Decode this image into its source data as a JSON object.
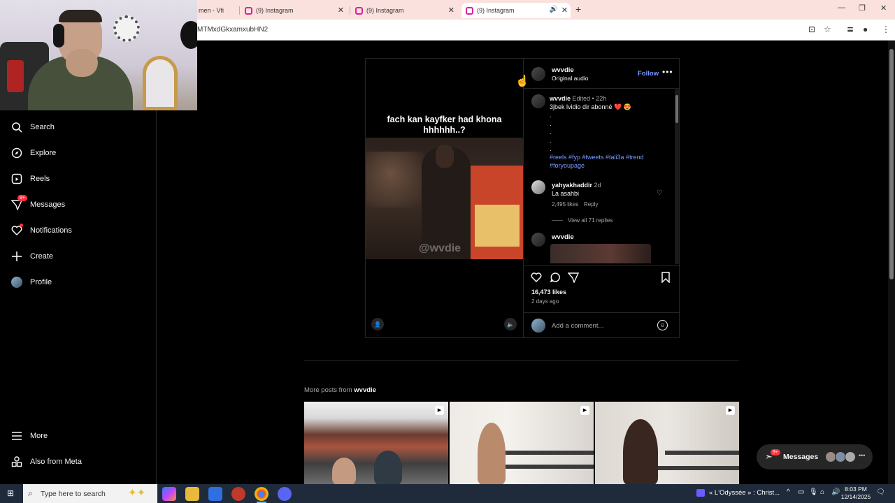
{
  "browser": {
    "tabs": [
      {
        "label": "men - Vfi"
      },
      {
        "label": "(9) Instagram"
      },
      {
        "label": "(9) Instagram"
      },
      {
        "label": "(9) Instagram"
      }
    ],
    "url": "MTMxdGkxamxubHN2"
  },
  "sidebar": {
    "items": [
      {
        "label": "Search"
      },
      {
        "label": "Explore"
      },
      {
        "label": "Reels"
      },
      {
        "label": "Messages",
        "badge": "9+"
      },
      {
        "label": "Notifications"
      },
      {
        "label": "Create"
      },
      {
        "label": "Profile"
      }
    ],
    "bottom": [
      {
        "label": "More"
      },
      {
        "label": "Also from Meta"
      }
    ]
  },
  "post": {
    "video_caption": "fach kan kayfker had khona hhhhhh..?",
    "watermark": "@wvdie",
    "header": {
      "username": "wvvdie",
      "audio": "Original audio",
      "follow": "Follow"
    },
    "caption": {
      "username": "wvvdie",
      "edited": "Edited",
      "sep": "•",
      "time": "22h",
      "text": "3jbek lvidio dir abonné ❤️ 😍",
      "dots": [
        ".",
        ".",
        ".",
        ".",
        "."
      ],
      "hashtags_1": "#reels #fyp #tweets #tali3a #trend",
      "hashtags_2": "#foryoupage"
    },
    "comment": {
      "username": "yahyakhaddir",
      "time": "2d",
      "text": "La asahbi",
      "likes": "2,495 likes",
      "reply": "Reply",
      "view_replies": "View all 71 replies"
    },
    "reply_user": "wvvdie",
    "likes": "16,473 likes",
    "posted": "2 days ago",
    "comment_placeholder": "Add a comment..."
  },
  "more_posts": {
    "prefix": "More posts from",
    "username": "wvvdie"
  },
  "messages_pill": {
    "label": "Messages",
    "badge": "9+"
  },
  "taskbar": {
    "search_placeholder": "Type here to search",
    "media": "« L'Odyssée » : Christ...",
    "time": "8:03 PM",
    "date": "12/14/2025"
  },
  "colors": {
    "accent_blue": "#7a9bff",
    "badge_red": "#ff3040",
    "background": "#000000"
  }
}
